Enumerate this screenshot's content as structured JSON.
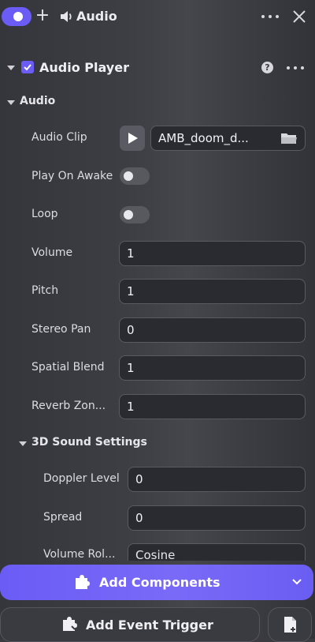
{
  "topbar": {
    "title": "Audio",
    "icons": [
      "toggle-pill",
      "plus-icon",
      "speaker-icon",
      "more-icon",
      "close-icon"
    ]
  },
  "component": {
    "title": "Audio Player",
    "enabled": true,
    "icons": [
      "help-icon",
      "more-icon"
    ]
  },
  "audio_section": {
    "title": "Audio",
    "audio_clip": {
      "label": "Audio Clip",
      "value": "AMB_doom_d..."
    },
    "play_on_awake": {
      "label": "Play On Awake",
      "checked": false
    },
    "loop": {
      "label": "Loop",
      "checked": false
    },
    "volume": {
      "label": "Volume",
      "value": "1"
    },
    "pitch": {
      "label": "Pitch",
      "value": "1"
    },
    "stereo_pan": {
      "label": "Stereo Pan",
      "value": "0"
    },
    "spatial_blend": {
      "label": "Spatial Blend",
      "value": "1"
    },
    "reverb_zone": {
      "label": "Reverb Zon...",
      "value": "1"
    }
  },
  "sound3d": {
    "title": "3D Sound Settings",
    "doppler": {
      "label": "Doppler Level",
      "value": "0"
    },
    "spread": {
      "label": "Spread",
      "value": "0"
    },
    "volume_rolloff": {
      "label": "Volume Rol...",
      "value": "Cosine"
    }
  },
  "footer": {
    "add_components": "Add Components",
    "add_event_trigger": "Add Event Trigger"
  },
  "colors": {
    "accent": "#6b5cf6",
    "panel": "#3a3a40",
    "field": "#2a2b30"
  }
}
